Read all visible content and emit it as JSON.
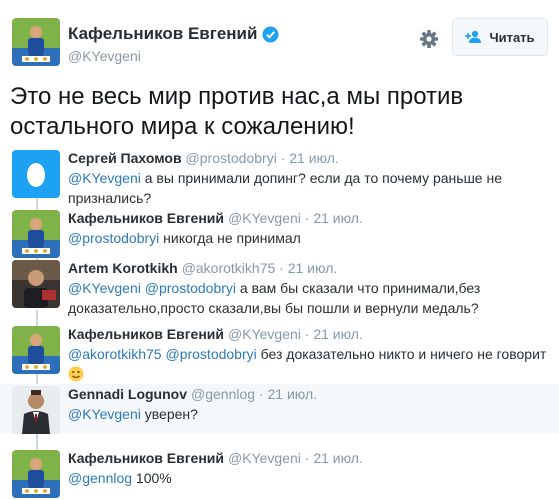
{
  "profile": {
    "name": "Кафельников Евгений",
    "handle": "@KYevgeni",
    "follow_label": "Читать"
  },
  "main_tweet": {
    "text": "Это не весь мир против нас,а мы против остального мира к сожалению!"
  },
  "replies": [
    {
      "name": "Сергей Пахомов",
      "handle": "@prostodobryi",
      "date": "· 21 июл.",
      "mentions": [
        "@KYevgeni"
      ],
      "text": " а вы принимали допинг? если да то почему раньше не признались?"
    },
    {
      "name": "Кафельников Евгений",
      "handle": "@KYevgeni",
      "date": "· 21 июл.",
      "mentions": [
        "@prostodobryi"
      ],
      "text": " никогда не принимал"
    },
    {
      "name": "Artem Korotkikh",
      "handle": "@akorotkikh75",
      "date": "· 21 июл.",
      "mentions": [
        "@KYevgeni",
        "@prostodobryi"
      ],
      "text": " а вам бы сказали что принимали,без доказательно,просто сказали,вы бы пошли и вернули медаль?"
    },
    {
      "name": "Кафельников Евгений",
      "handle": "@KYevgeni",
      "date": "· 21 июл.",
      "mentions": [
        "@akorotkikh75",
        "@prostodobryi"
      ],
      "text": " без доказательно никто и ничего не говорит"
    },
    {
      "name": "Gennadi Logunov",
      "handle": "@gennlog",
      "date": "· 21 июл.",
      "mentions": [
        "@KYevgeni"
      ],
      "text": " уверен?"
    },
    {
      "name": "Кафельников Евгений",
      "handle": "@KYevgeni",
      "date": "· 21 июл.",
      "mentions": [
        "@gennlog"
      ],
      "text": " 100%"
    }
  ],
  "icons": {
    "verified": "verified-badge-icon",
    "settings": "gear-icon",
    "follow": "add-user-icon",
    "emoji": "winking-face-icon"
  },
  "colors": {
    "link": "#2b7bb9",
    "verified": "#1da1f2",
    "muted": "#8899a6",
    "highlight_bg": "#f5f8fa"
  }
}
